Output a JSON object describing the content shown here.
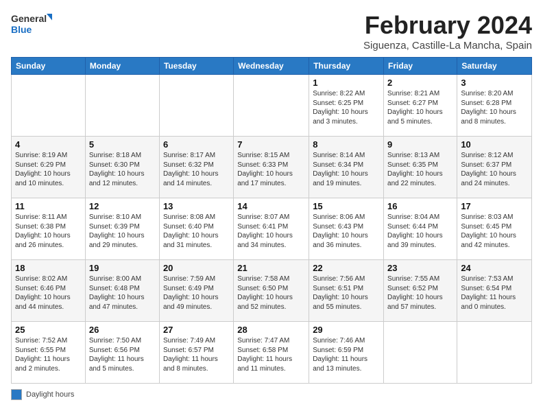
{
  "header": {
    "logo_line1": "General",
    "logo_line2": "Blue",
    "month_title": "February 2024",
    "subtitle": "Siguenza, Castille-La Mancha, Spain"
  },
  "days_of_week": [
    "Sunday",
    "Monday",
    "Tuesday",
    "Wednesday",
    "Thursday",
    "Friday",
    "Saturday"
  ],
  "weeks": [
    [
      {
        "day": "",
        "info": ""
      },
      {
        "day": "",
        "info": ""
      },
      {
        "day": "",
        "info": ""
      },
      {
        "day": "",
        "info": ""
      },
      {
        "day": "1",
        "info": "Sunrise: 8:22 AM\nSunset: 6:25 PM\nDaylight: 10 hours and 3 minutes."
      },
      {
        "day": "2",
        "info": "Sunrise: 8:21 AM\nSunset: 6:27 PM\nDaylight: 10 hours and 5 minutes."
      },
      {
        "day": "3",
        "info": "Sunrise: 8:20 AM\nSunset: 6:28 PM\nDaylight: 10 hours and 8 minutes."
      }
    ],
    [
      {
        "day": "4",
        "info": "Sunrise: 8:19 AM\nSunset: 6:29 PM\nDaylight: 10 hours and 10 minutes."
      },
      {
        "day": "5",
        "info": "Sunrise: 8:18 AM\nSunset: 6:30 PM\nDaylight: 10 hours and 12 minutes."
      },
      {
        "day": "6",
        "info": "Sunrise: 8:17 AM\nSunset: 6:32 PM\nDaylight: 10 hours and 14 minutes."
      },
      {
        "day": "7",
        "info": "Sunrise: 8:15 AM\nSunset: 6:33 PM\nDaylight: 10 hours and 17 minutes."
      },
      {
        "day": "8",
        "info": "Sunrise: 8:14 AM\nSunset: 6:34 PM\nDaylight: 10 hours and 19 minutes."
      },
      {
        "day": "9",
        "info": "Sunrise: 8:13 AM\nSunset: 6:35 PM\nDaylight: 10 hours and 22 minutes."
      },
      {
        "day": "10",
        "info": "Sunrise: 8:12 AM\nSunset: 6:37 PM\nDaylight: 10 hours and 24 minutes."
      }
    ],
    [
      {
        "day": "11",
        "info": "Sunrise: 8:11 AM\nSunset: 6:38 PM\nDaylight: 10 hours and 26 minutes."
      },
      {
        "day": "12",
        "info": "Sunrise: 8:10 AM\nSunset: 6:39 PM\nDaylight: 10 hours and 29 minutes."
      },
      {
        "day": "13",
        "info": "Sunrise: 8:08 AM\nSunset: 6:40 PM\nDaylight: 10 hours and 31 minutes."
      },
      {
        "day": "14",
        "info": "Sunrise: 8:07 AM\nSunset: 6:41 PM\nDaylight: 10 hours and 34 minutes."
      },
      {
        "day": "15",
        "info": "Sunrise: 8:06 AM\nSunset: 6:43 PM\nDaylight: 10 hours and 36 minutes."
      },
      {
        "day": "16",
        "info": "Sunrise: 8:04 AM\nSunset: 6:44 PM\nDaylight: 10 hours and 39 minutes."
      },
      {
        "day": "17",
        "info": "Sunrise: 8:03 AM\nSunset: 6:45 PM\nDaylight: 10 hours and 42 minutes."
      }
    ],
    [
      {
        "day": "18",
        "info": "Sunrise: 8:02 AM\nSunset: 6:46 PM\nDaylight: 10 hours and 44 minutes."
      },
      {
        "day": "19",
        "info": "Sunrise: 8:00 AM\nSunset: 6:48 PM\nDaylight: 10 hours and 47 minutes."
      },
      {
        "day": "20",
        "info": "Sunrise: 7:59 AM\nSunset: 6:49 PM\nDaylight: 10 hours and 49 minutes."
      },
      {
        "day": "21",
        "info": "Sunrise: 7:58 AM\nSunset: 6:50 PM\nDaylight: 10 hours and 52 minutes."
      },
      {
        "day": "22",
        "info": "Sunrise: 7:56 AM\nSunset: 6:51 PM\nDaylight: 10 hours and 55 minutes."
      },
      {
        "day": "23",
        "info": "Sunrise: 7:55 AM\nSunset: 6:52 PM\nDaylight: 10 hours and 57 minutes."
      },
      {
        "day": "24",
        "info": "Sunrise: 7:53 AM\nSunset: 6:54 PM\nDaylight: 11 hours and 0 minutes."
      }
    ],
    [
      {
        "day": "25",
        "info": "Sunrise: 7:52 AM\nSunset: 6:55 PM\nDaylight: 11 hours and 2 minutes."
      },
      {
        "day": "26",
        "info": "Sunrise: 7:50 AM\nSunset: 6:56 PM\nDaylight: 11 hours and 5 minutes."
      },
      {
        "day": "27",
        "info": "Sunrise: 7:49 AM\nSunset: 6:57 PM\nDaylight: 11 hours and 8 minutes."
      },
      {
        "day": "28",
        "info": "Sunrise: 7:47 AM\nSunset: 6:58 PM\nDaylight: 11 hours and 11 minutes."
      },
      {
        "day": "29",
        "info": "Sunrise: 7:46 AM\nSunset: 6:59 PM\nDaylight: 11 hours and 13 minutes."
      },
      {
        "day": "",
        "info": ""
      },
      {
        "day": "",
        "info": ""
      }
    ]
  ],
  "legend": {
    "color_label": "Daylight hours"
  }
}
